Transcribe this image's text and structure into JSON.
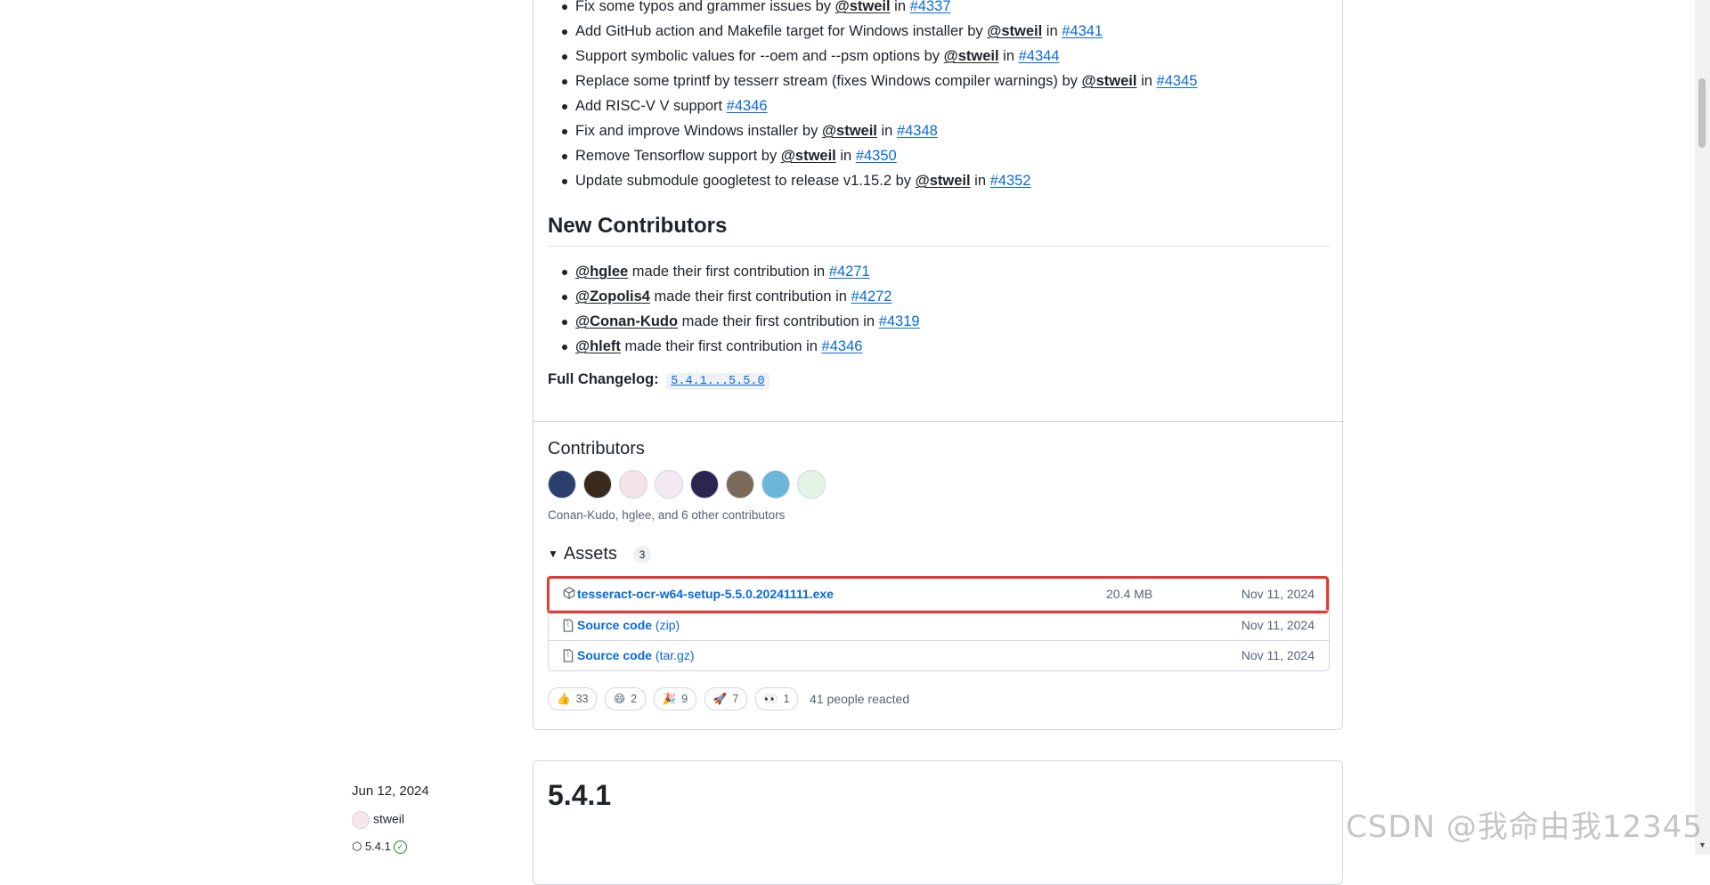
{
  "changes": [
    {
      "text": "Fix some typos and grammer issues by",
      "user": "@stweil",
      "sep": "in",
      "pr": "#4337"
    },
    {
      "text": "Add GitHub action and Makefile target for Windows installer by",
      "user": "@stweil",
      "sep": "in",
      "pr": "#4341"
    },
    {
      "text": "Support symbolic values for --oem and --psm options by",
      "user": "@stweil",
      "sep": "in",
      "pr": "#4344"
    },
    {
      "text": "Replace some tprintf by tesserr stream (fixes Windows compiler warnings) by",
      "user": "@stweil",
      "sep": "in",
      "pr": "#4345"
    },
    {
      "text": "Add RISC-V V support",
      "user": "",
      "sep": "",
      "pr": "#4346"
    },
    {
      "text": "Fix and improve Windows installer by",
      "user": "@stweil",
      "sep": "in",
      "pr": "#4348"
    },
    {
      "text": "Remove Tensorflow support by",
      "user": "@stweil",
      "sep": "in",
      "pr": "#4350"
    },
    {
      "text": "Update submodule googletest to release v1.15.2 by",
      "user": "@stweil",
      "sep": "in",
      "pr": "#4352"
    }
  ],
  "new_contributors": {
    "heading": "New Contributors",
    "items": [
      {
        "user": "@hglee",
        "text": "made their first contribution in",
        "pr": "#4271"
      },
      {
        "user": "@Zopolis4",
        "text": "made their first contribution in",
        "pr": "#4272"
      },
      {
        "user": "@Conan-Kudo",
        "text": "made their first contribution in",
        "pr": "#4319"
      },
      {
        "user": "@hleft",
        "text": "made their first contribution in",
        "pr": "#4346"
      }
    ]
  },
  "changelog": {
    "label": "Full Changelog:",
    "range": "5.4.1...5.5.0"
  },
  "contributors": {
    "title": "Contributors",
    "summary": "Conan-Kudo, hglee, and 6 other contributors",
    "avatars": [
      {
        "color": "#2c3e6b"
      },
      {
        "color": "#3a2a1e"
      },
      {
        "color": "#f3e3e8"
      },
      {
        "color": "#f5e9f3"
      },
      {
        "color": "#2b2550"
      },
      {
        "color": "#7a6a5a"
      },
      {
        "color": "#6ab7d9"
      },
      {
        "color": "#e4f4e4"
      }
    ]
  },
  "assets": {
    "title": "Assets",
    "count": "3",
    "rows": [
      {
        "icon": "package-icon",
        "name": "tesseract-ocr-w64-setup-5.5.0.20241111.exe",
        "ext": "",
        "size": "20.4 MB",
        "date": "Nov 11, 2024"
      },
      {
        "icon": "file-zip-icon",
        "name": "Source code",
        "ext": "(zip)",
        "size": "",
        "date": "Nov 11, 2024"
      },
      {
        "icon": "file-zip-icon",
        "name": "Source code",
        "ext": "(tar.gz)",
        "size": "",
        "date": "Nov 11, 2024"
      }
    ]
  },
  "reactions": {
    "items": [
      {
        "emoji": "👍",
        "count": "33"
      },
      {
        "emoji": "😄",
        "count": "2"
      },
      {
        "emoji": "🎉",
        "count": "9"
      },
      {
        "emoji": "🚀",
        "count": "7"
      },
      {
        "emoji": "👀",
        "count": "1"
      }
    ],
    "summary": "41 people reacted"
  },
  "next_release": {
    "date": "Jun 12, 2024",
    "author": "stweil",
    "tag": "5.4.1",
    "title": "5.4.1"
  },
  "watermark": "CSDN @我命由我12345",
  "colors": {
    "link": "#0969da",
    "highlight": "#e53935",
    "border": "#d0d7de"
  }
}
